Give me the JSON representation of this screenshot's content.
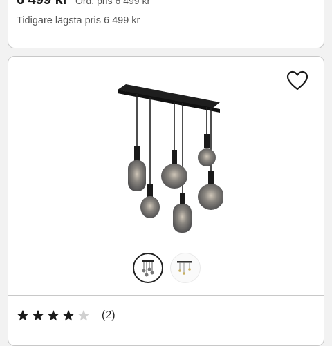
{
  "price": {
    "current": "6 499 kr",
    "ordinary": "Ord. pris 6 499 kr",
    "previous_lowest": "Tidigare lägsta pris 6 499 kr"
  },
  "product": {
    "favorite_icon": "heart-outline-icon",
    "image_icon": "pendant-lamp-image",
    "thumbnails": [
      {
        "icon": "thumbnail-lamp-dark",
        "selected": true
      },
      {
        "icon": "thumbnail-lamp-light",
        "selected": false
      }
    ]
  },
  "rating": {
    "stars_filled": 4,
    "stars_total": 5,
    "review_count": "(2)"
  },
  "colors": {
    "star_filled": "#1a1a1a",
    "star_empty": "#d0d0d0",
    "border": "#c8c8c8"
  }
}
